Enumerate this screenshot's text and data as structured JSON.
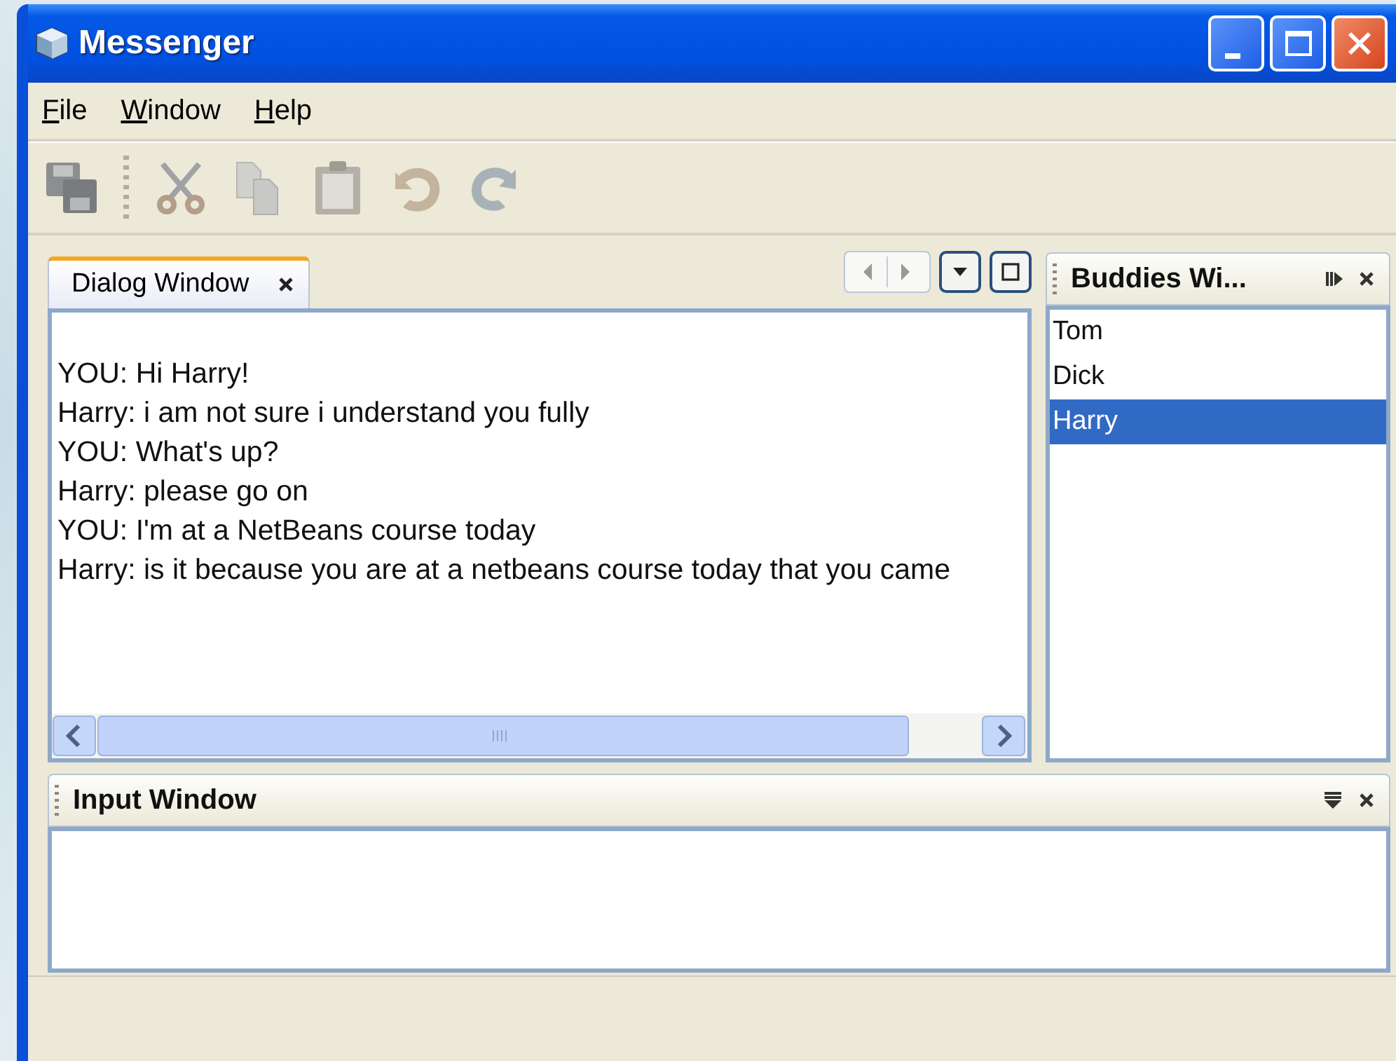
{
  "window": {
    "title": "Messenger"
  },
  "menu": [
    {
      "label": "File"
    },
    {
      "label": "Window"
    },
    {
      "label": "Help"
    }
  ],
  "toolbar": [
    {
      "kind": "save",
      "disabled": true
    },
    {
      "kind": "cut",
      "disabled": true
    },
    {
      "kind": "copy",
      "disabled": true
    },
    {
      "kind": "paste",
      "disabled": true
    },
    {
      "kind": "undo",
      "disabled": true
    },
    {
      "kind": "redo",
      "disabled": true
    }
  ],
  "dialog": {
    "tabs": [
      {
        "label": "Dialog Window",
        "selected": true
      }
    ],
    "messages": [
      "YOU: Hi Harry!",
      "Harry: i am not sure i understand you fully",
      "YOU: What's up?",
      "Harry: please go on",
      "YOU: I'm at a NetBeans course today",
      "Harry: is it because you are at a netbeans course today that you came"
    ]
  },
  "buddies": {
    "title": "Buddies Wi...",
    "items": [
      {
        "name": "Tom",
        "selected": false
      },
      {
        "name": "Dick",
        "selected": false
      },
      {
        "name": "Harry",
        "selected": true
      }
    ]
  },
  "input": {
    "title": "Input Window"
  }
}
